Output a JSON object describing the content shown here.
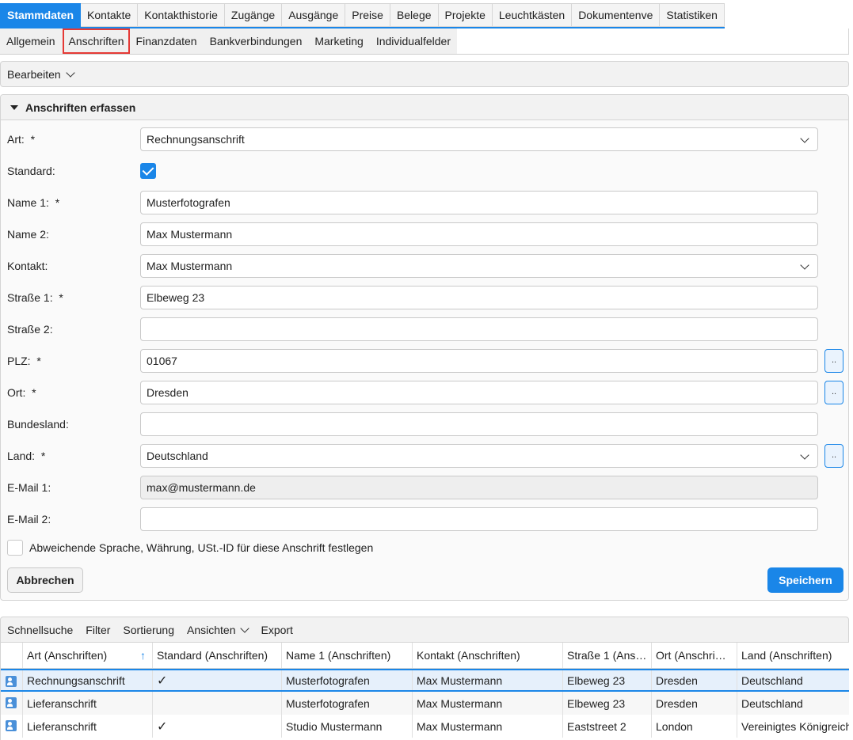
{
  "tabs_main": [
    "Stammdaten",
    "Kontakte",
    "Kontakthistorie",
    "Zugänge",
    "Ausgänge",
    "Preise",
    "Belege",
    "Projekte",
    "Leuchtkästen",
    "Dokumentenve",
    "Statistiken"
  ],
  "tabs_sub": [
    "Allgemein",
    "Anschriften",
    "Finanzdaten",
    "Bankverbindungen",
    "Marketing",
    "Individualfelder"
  ],
  "toolbar": {
    "edit_label": "Bearbeiten"
  },
  "panel": {
    "title": "Anschriften erfassen"
  },
  "form": {
    "art_label": "Art:",
    "art_value": "Rechnungsanschrift",
    "standard_label": "Standard:",
    "name1_label": "Name 1:",
    "name1_value": "Musterfotografen",
    "name2_label": "Name 2:",
    "name2_value": "Max Mustermann",
    "kontakt_label": "Kontakt:",
    "kontakt_value": "Max Mustermann",
    "strasse1_label": "Straße 1:",
    "strasse1_value": "Elbeweg 23",
    "strasse2_label": "Straße 2:",
    "strasse2_value": "",
    "plz_label": "PLZ:",
    "plz_value": "01067",
    "ort_label": "Ort:",
    "ort_value": "Dresden",
    "bundesland_label": "Bundesland:",
    "bundesland_value": "",
    "land_label": "Land:",
    "land_value": "Deutschland",
    "email1_label": "E-Mail 1:",
    "email1_value": "max@mustermann.de",
    "email2_label": "E-Mail 2:",
    "email2_value": "",
    "required_mark": "*",
    "lookup_label": "..",
    "abweichend_label": "Abweichende Sprache, Währung, USt.-ID für diese Anschrift festlegen",
    "cancel_label": "Abbrechen",
    "save_label": "Speichern"
  },
  "grid_toolbar": [
    "Schnellsuche",
    "Filter",
    "Sortierung",
    "Ansichten",
    "Export"
  ],
  "grid": {
    "columns": [
      "Art (Anschriften)",
      "Standard (Anschriften)",
      "Name 1 (Anschriften)",
      "Kontakt (Anschriften)",
      "Straße 1 (Ans…",
      "Ort (Anschri…",
      "Land (Anschriften)"
    ],
    "check_mark": "✓",
    "rows": [
      {
        "art": "Rechnungsanschrift",
        "standard": true,
        "name1": "Musterfotografen",
        "kontakt": "Max Mustermann",
        "strasse": "Elbeweg 23",
        "ort": "Dresden",
        "land": "Deutschland"
      },
      {
        "art": "Lieferanschrift",
        "standard": false,
        "name1": "Musterfotografen",
        "kontakt": "Max Mustermann",
        "strasse": "Elbeweg 23",
        "ort": "Dresden",
        "land": "Deutschland"
      },
      {
        "art": "Lieferanschrift",
        "standard": true,
        "name1": "Studio Mustermann",
        "kontakt": "Max Mustermann",
        "strasse": "Eaststreet 2",
        "ort": "London",
        "land": "Vereinigtes Königreich"
      }
    ]
  },
  "colors": {
    "accent": "#1a86e8",
    "highlight": "#e53935"
  }
}
